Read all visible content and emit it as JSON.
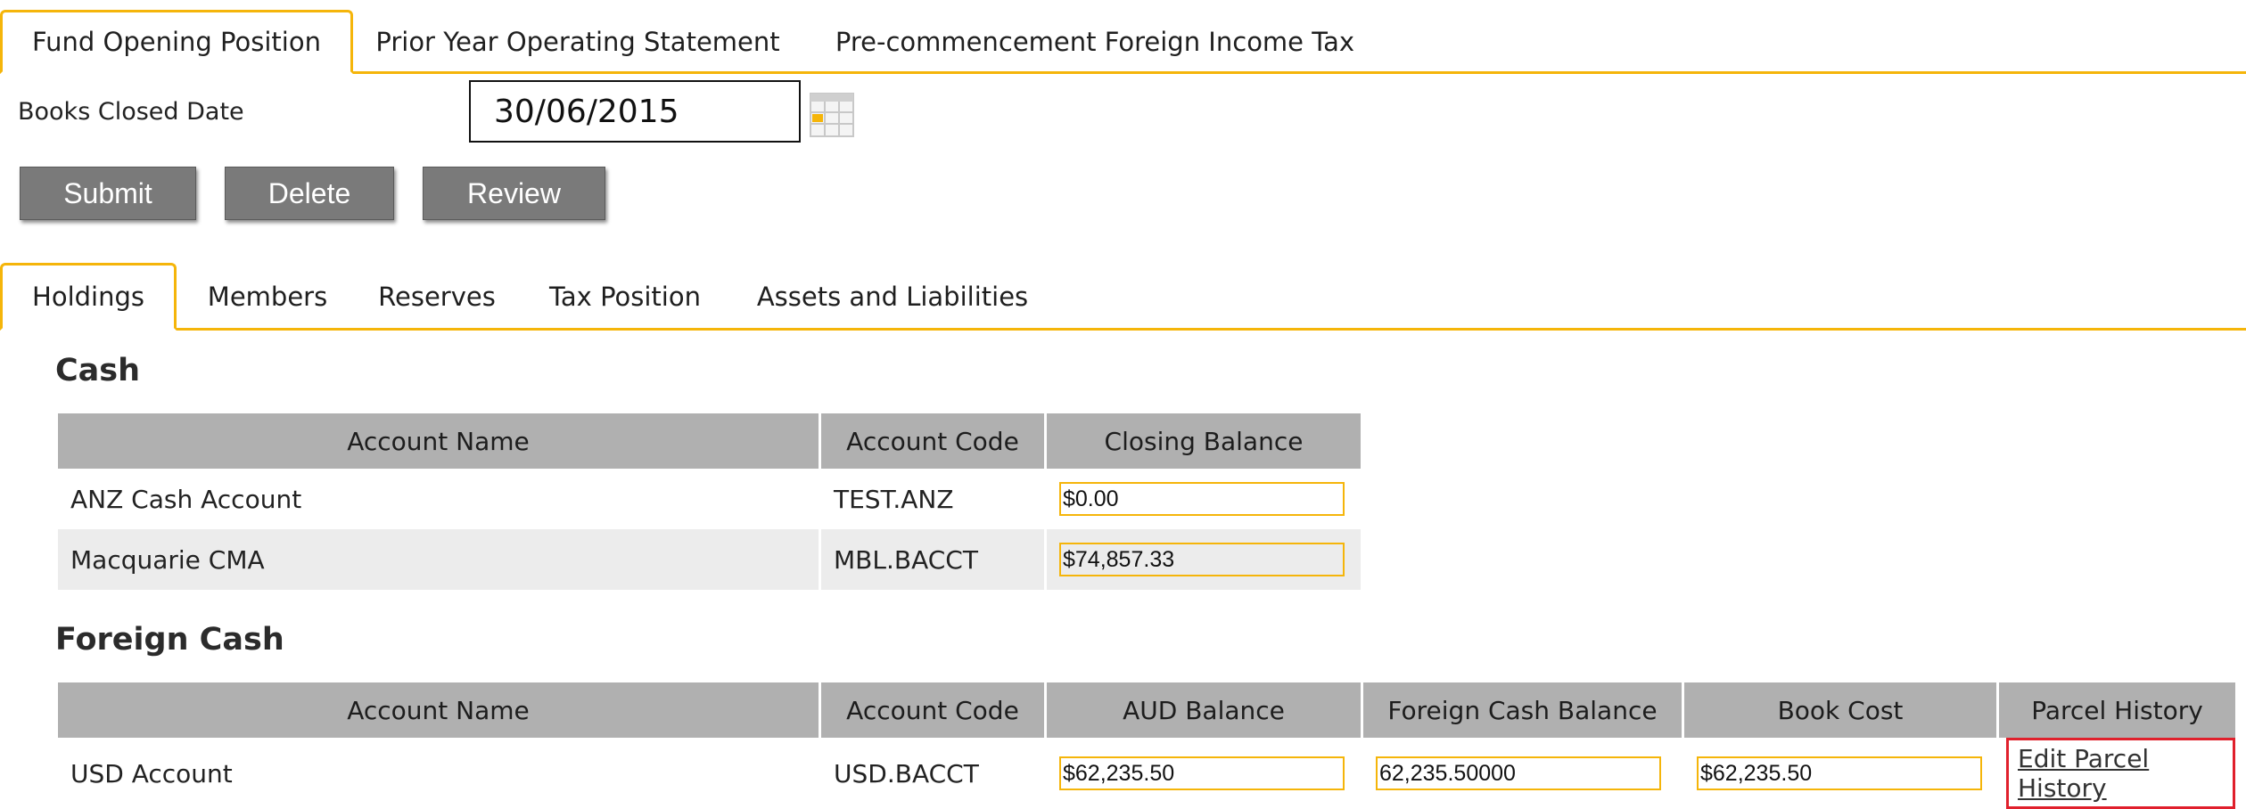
{
  "top_tabs": [
    {
      "label": "Fund Opening Position",
      "active": true
    },
    {
      "label": "Prior Year Operating Statement",
      "active": false
    },
    {
      "label": "Pre-commencement Foreign Income Tax",
      "active": false
    }
  ],
  "books_closed": {
    "label": "Books Closed Date",
    "value": "30/06/2015"
  },
  "buttons": {
    "submit": "Submit",
    "delete": "Delete",
    "review": "Review"
  },
  "sub_tabs": [
    {
      "label": "Holdings",
      "active": true
    },
    {
      "label": "Members",
      "active": false
    },
    {
      "label": "Reserves",
      "active": false
    },
    {
      "label": "Tax Position",
      "active": false
    },
    {
      "label": "Assets and Liabilities",
      "active": false
    }
  ],
  "cash": {
    "title": "Cash",
    "headers": [
      "Account Name",
      "Account Code",
      "Closing Balance"
    ],
    "rows": [
      {
        "name": "ANZ Cash Account",
        "code": "TEST.ANZ",
        "closing": "$0.00"
      },
      {
        "name": "Macquarie CMA",
        "code": "MBL.BACCT",
        "closing": "$74,857.33"
      }
    ]
  },
  "foreign_cash": {
    "title": "Foreign Cash",
    "headers": [
      "Account Name",
      "Account Code",
      "AUD Balance",
      "Foreign Cash Balance",
      "Book Cost",
      "Parcel History"
    ],
    "rows": [
      {
        "name": "USD Account",
        "code": "USD.BACCT",
        "aud": "$62,235.50",
        "foreign": "62,235.50000",
        "book": "$62,235.50",
        "parcel_link": "Edit Parcel History"
      }
    ]
  },
  "colors": {
    "accent": "#f5b50a",
    "header_bg": "#b0b0b0",
    "button_bg": "#7a7a7a",
    "highlight": "#e0202c"
  }
}
